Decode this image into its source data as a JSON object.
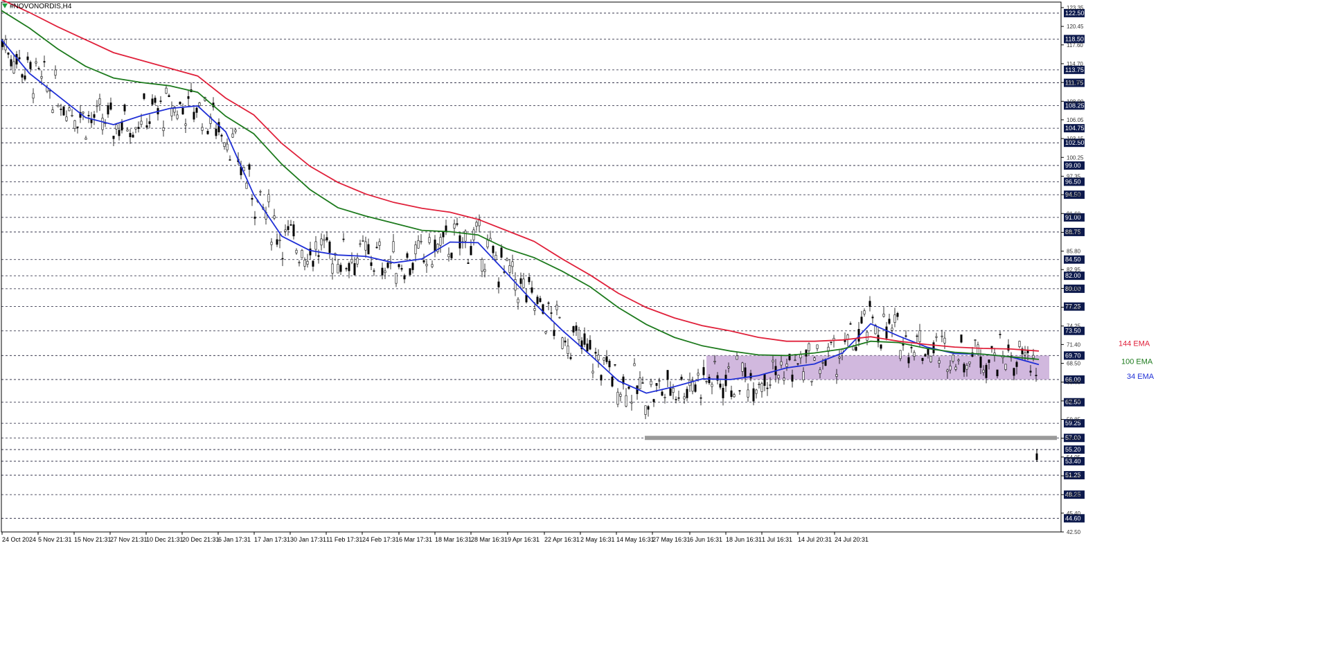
{
  "window": {
    "title": "#NOVONORDIS,H4"
  },
  "colors": {
    "background": "#ffffff",
    "grid": "#1a1a33",
    "ema34": "#1f2fd6",
    "ema100": "#1d7a1d",
    "ema144": "#e0203a",
    "zone": "#c6a6d6",
    "support_bar": "#9a9a9a",
    "price_label_bg": "#0d1a4d"
  },
  "chart_data": {
    "type": "line",
    "symbol": "#NOVONORDIS",
    "timeframe": "H4",
    "price_axis_ticks": [
      "123.35",
      "120.45",
      "117.60",
      "114.70",
      "111.80",
      "108.90",
      "106.05",
      "103.15",
      "100.25",
      "97.35",
      "94.50",
      "91.60",
      "88.70",
      "85.80",
      "82.95",
      "80.05",
      "77.15",
      "74.25",
      "71.40",
      "68.50",
      "65.60",
      "62.70",
      "59.85",
      "56.95",
      "54.05",
      "51.15",
      "48.25",
      "45.40",
      "42.50"
    ],
    "ylim": [
      42.5,
      124.2
    ],
    "level_labels": [
      "122.50",
      "118.50",
      "113.75",
      "111.75",
      "108.25",
      "104.75",
      "102.50",
      "99.00",
      "96.50",
      "94.50",
      "91.00",
      "88.75",
      "84.50",
      "82.00",
      "80.00",
      "77.25",
      "73.50",
      "69.70",
      "66.00",
      "62.50",
      "59.25",
      "57.00",
      "55.20",
      "53.40",
      "51.25",
      "48.25",
      "44.60"
    ],
    "time_axis_labels": [
      "24 Oct 2024",
      "5 Nov 21:31",
      "15 Nov 21:31",
      "27 Nov 21:31",
      "10 Dec 21:31",
      "20 Dec 21:31",
      "6 Jan 17:31",
      "17 Jan 17:31",
      "30 Jan 17:31",
      "11 Feb 17:31",
      "24 Feb 17:31",
      "6 Mar 17:31",
      "18 Mar 16:31",
      "28 Mar 16:31",
      "9 Apr 16:31",
      "22 Apr 16:31",
      "2 May 16:31",
      "14 May 16:31",
      "27 May 16:31",
      "6 Jun 16:31",
      "18 Jun 16:31",
      "1 Jul 16:31",
      "14 Jul 20:31",
      "24 Jul 20:31"
    ],
    "series": [
      {
        "name": "34 EMA",
        "values": [
          118.4,
          113.2,
          109.8,
          106.4,
          105.3,
          106.7,
          107.8,
          108.2,
          104.2,
          94.5,
          88.1,
          85.9,
          85.2,
          85.0,
          84.0,
          84.6,
          87.2,
          87.1,
          82.5,
          77.8,
          73.6,
          69.8,
          65.8,
          63.9,
          64.9,
          66.1,
          66.0,
          66.6,
          67.8,
          68.4,
          70.1,
          74.6,
          72.7,
          71.0,
          70.0,
          69.9,
          69.5,
          68.3
        ]
      },
      {
        "name": "100 EMA",
        "values": [
          122.9,
          120.2,
          117.0,
          114.3,
          112.5,
          111.8,
          111.3,
          110.3,
          106.6,
          103.9,
          99.2,
          95.3,
          92.5,
          91.2,
          90.1,
          89.0,
          88.8,
          88.3,
          86.2,
          84.8,
          82.7,
          80.3,
          77.1,
          74.5,
          72.5,
          71.2,
          70.4,
          69.8,
          69.7,
          70.1,
          70.7,
          71.9,
          71.7,
          70.8,
          70.2,
          69.9,
          69.5,
          69.1
        ]
      },
      {
        "name": "144 EMA",
        "values": [
          124.6,
          122.6,
          120.4,
          118.4,
          116.4,
          115.2,
          114.0,
          112.8,
          109.4,
          106.8,
          102.4,
          98.9,
          96.4,
          94.6,
          93.3,
          92.4,
          91.8,
          90.7,
          89.0,
          87.3,
          84.6,
          82.1,
          79.3,
          77.1,
          75.5,
          74.3,
          73.5,
          72.5,
          71.9,
          71.9,
          72.1,
          72.6,
          71.9,
          71.4,
          71.0,
          70.8,
          70.7,
          70.4
        ]
      }
    ],
    "annotations": [
      "144 EMA",
      "100 EMA",
      "34 EMA"
    ],
    "zone": {
      "from": 66.0,
      "to": 69.7
    },
    "support_level": 57.0,
    "grid": true,
    "legend": "right"
  }
}
